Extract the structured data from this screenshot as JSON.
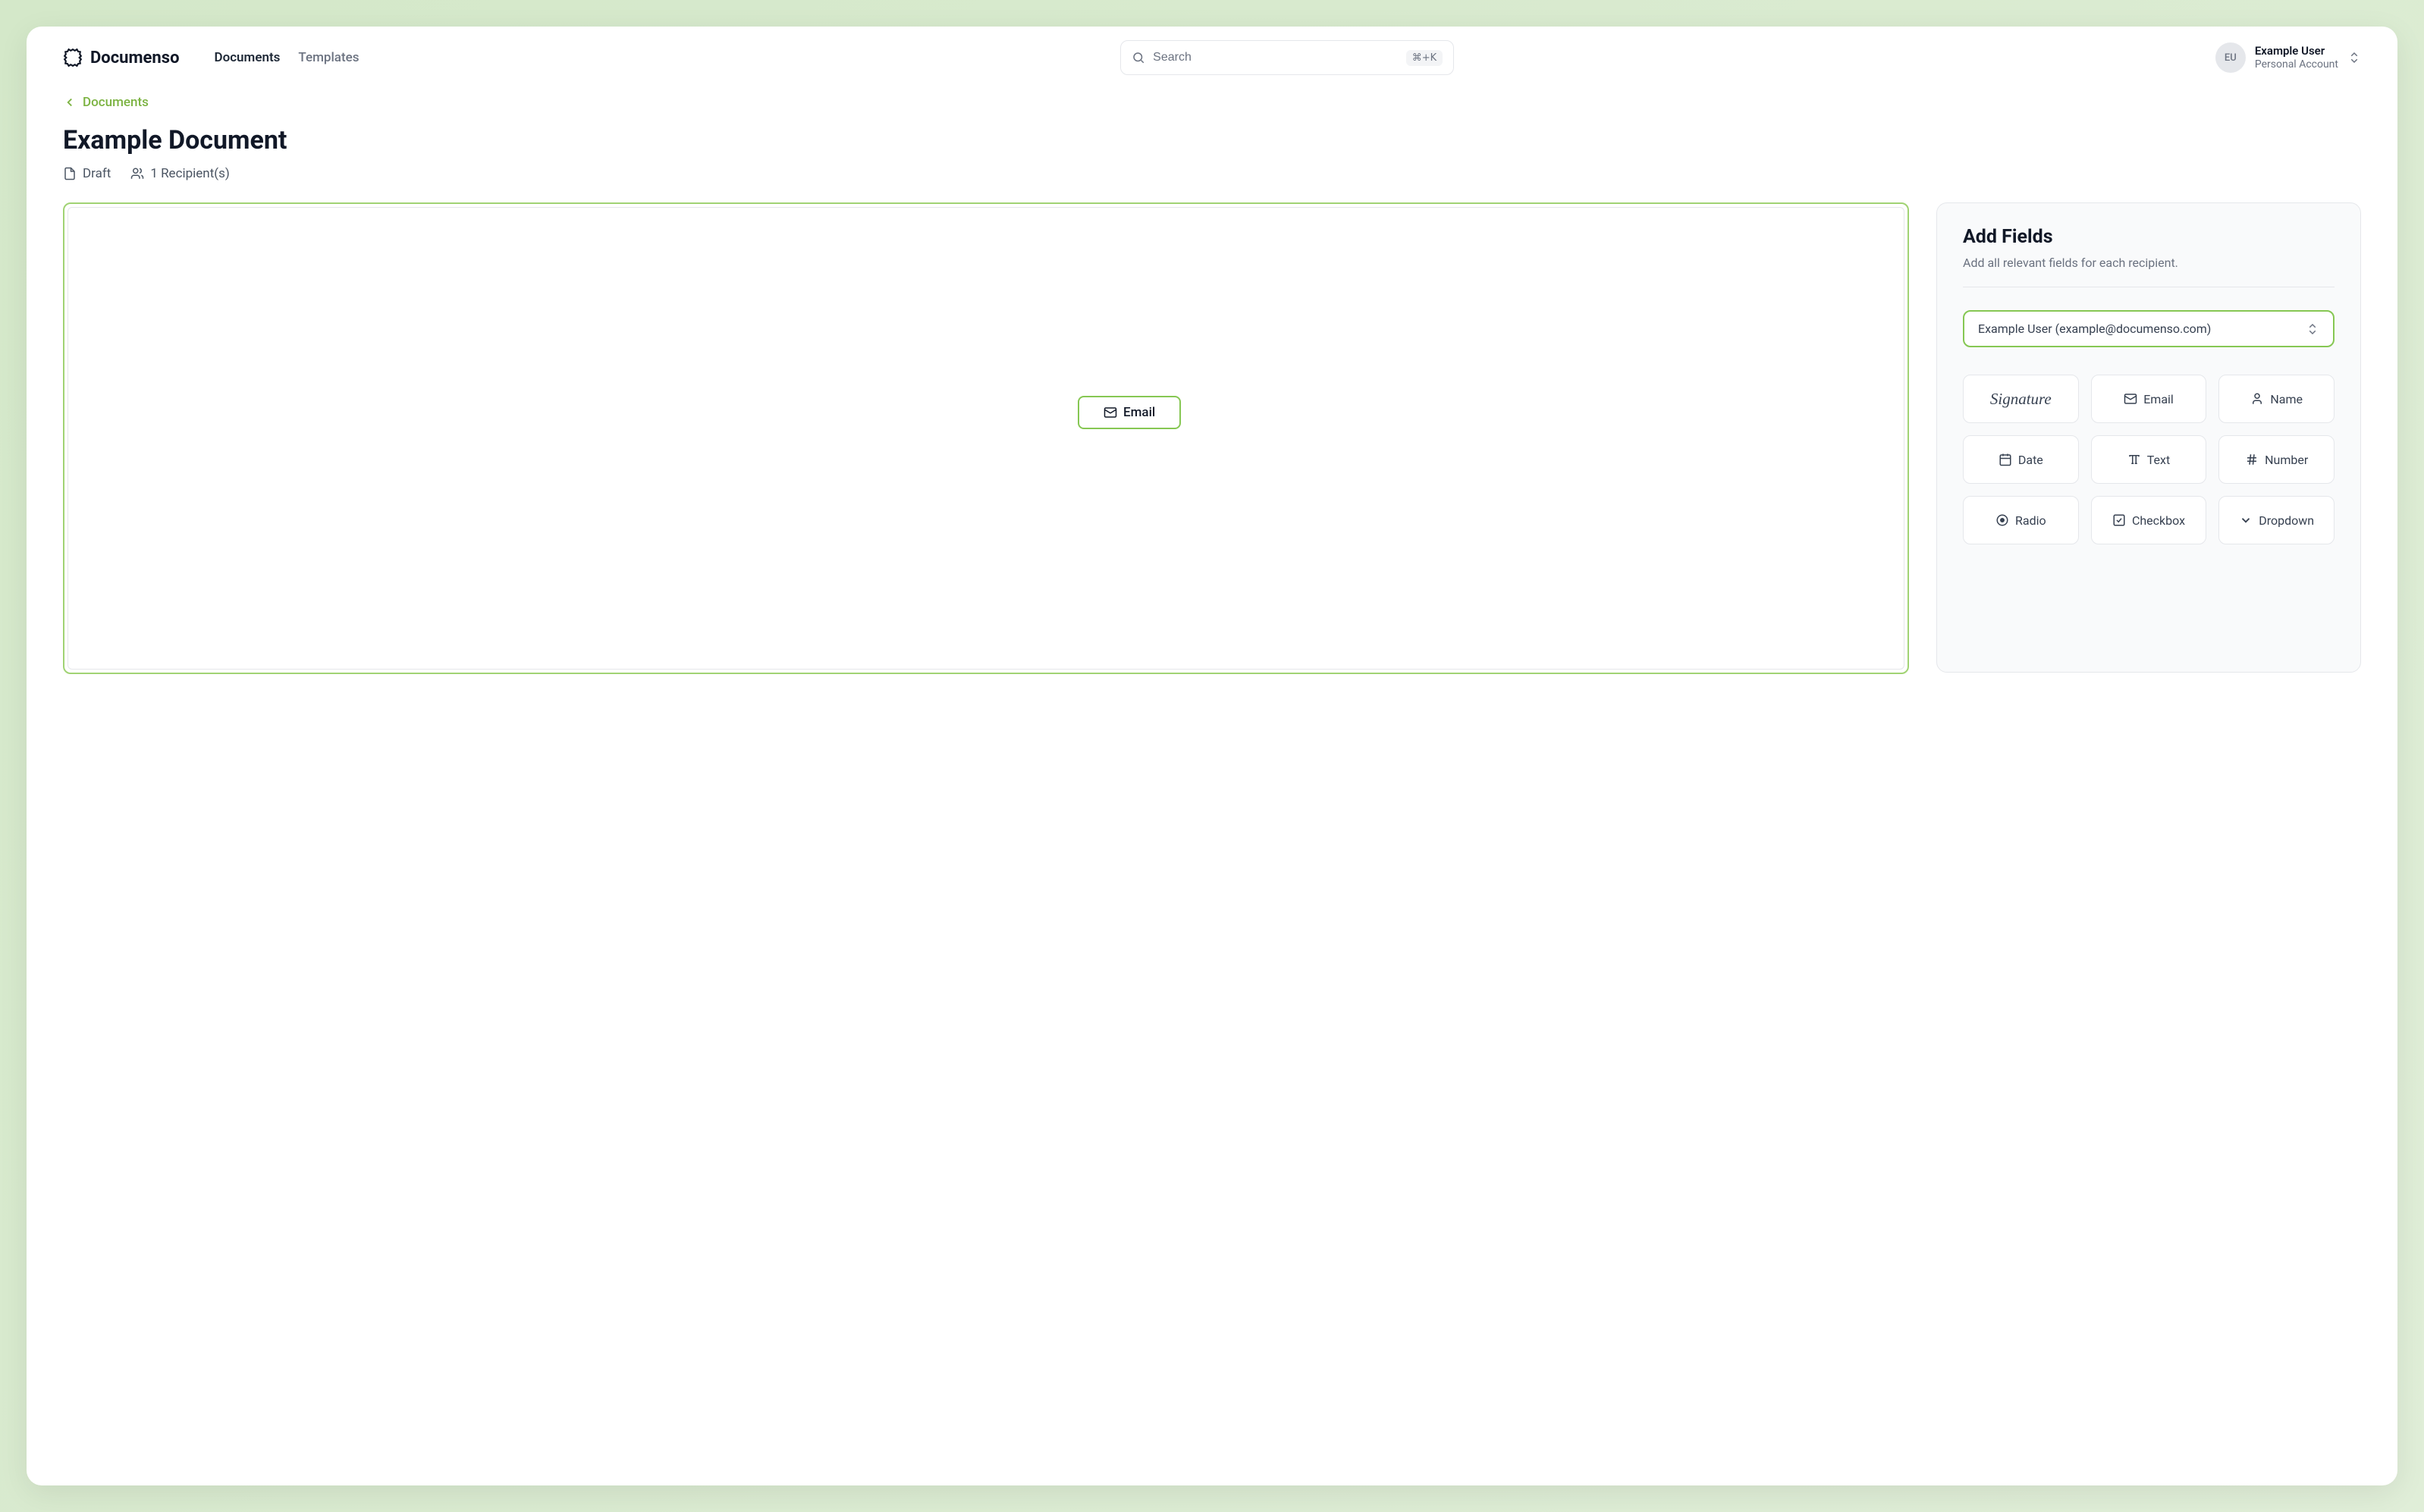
{
  "brand": {
    "name": "Documenso"
  },
  "nav": {
    "documents": "Documents",
    "templates": "Templates"
  },
  "search": {
    "placeholder": "Search",
    "shortcut": "⌘+K"
  },
  "user": {
    "initials": "EU",
    "name": "Example User",
    "account": "Personal Account"
  },
  "breadcrumb": {
    "label": "Documents"
  },
  "document": {
    "title": "Example Document",
    "status": "Draft",
    "recipients": "1 Recipient(s)"
  },
  "canvas": {
    "placed_field": {
      "label": "Email"
    }
  },
  "panel": {
    "title": "Add Fields",
    "subtitle": "Add all relevant fields for each recipient.",
    "recipient": "Example User (example@documenso.com)",
    "fields": {
      "signature": "Signature",
      "email": "Email",
      "name": "Name",
      "date": "Date",
      "text": "Text",
      "number": "Number",
      "radio": "Radio",
      "checkbox": "Checkbox",
      "dropdown": "Dropdown"
    }
  }
}
